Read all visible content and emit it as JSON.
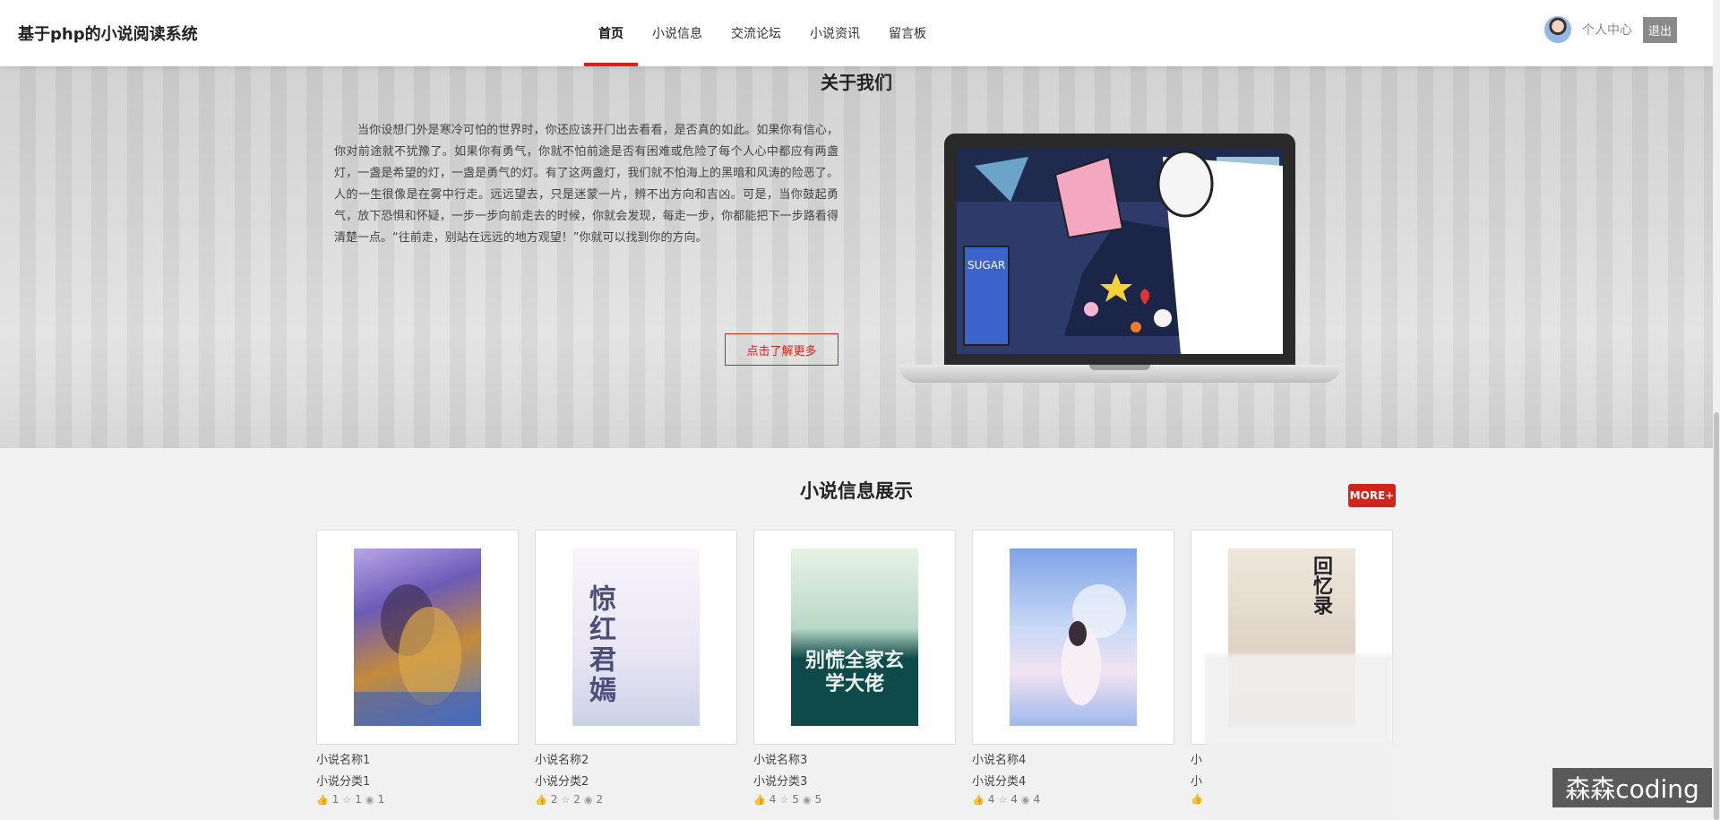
{
  "header": {
    "site_title": "基于php的小说阅读系统",
    "nav": [
      {
        "label": "首页",
        "active": true
      },
      {
        "label": "小说信息",
        "active": false
      },
      {
        "label": "交流论坛",
        "active": false
      },
      {
        "label": "小说资讯",
        "active": false
      },
      {
        "label": "留言板",
        "active": false
      }
    ],
    "user_center": "个人中心",
    "logout": "退出"
  },
  "about": {
    "title": "关于我们",
    "text": "当你设想门外是寒冷可怕的世界时，你还应该开门出去看看，是否真的如此。如果你有信心，你对前途就不犹豫了。如果你有勇气，你就不怕前途是否有困难或危险了每个人心中都应有两盏灯，一盏是希望的灯，一盏是勇气的灯。有了这两盏灯，我们就不怕海上的黑暗和风涛的险恶了。人的一生很像是在雾中行走。远远望去，只是迷蒙一片，辨不出方向和吉凶。可是，当你鼓起勇气，放下恐惧和怀疑，一步一步向前走去的时候，你就会发现，每走一步，你都能把下一步路看得清楚一点。“往前走，别站在远远的地方观望！”你就可以找到你的方向。",
    "more_button": "点击了解更多",
    "illustration_text": "SUGAR"
  },
  "novels": {
    "title": "小说信息展示",
    "more_badge": "MORE+",
    "items": [
      {
        "name": "小说名称1",
        "category": "小说分类1",
        "likes": "1",
        "favorites": "1",
        "views": "1",
        "cover_text": ""
      },
      {
        "name": "小说名称2",
        "category": "小说分类2",
        "likes": "2",
        "favorites": "2",
        "views": "2",
        "cover_text": "惊红君嫣"
      },
      {
        "name": "小说名称3",
        "category": "小说分类3",
        "likes": "4",
        "favorites": "5",
        "views": "5",
        "cover_text": "别慌全家玄学大佬"
      },
      {
        "name": "小说名称4",
        "category": "小说分类4",
        "likes": "4",
        "favorites": "4",
        "views": "4",
        "cover_text": ""
      },
      {
        "name": "小",
        "category": "小",
        "likes": "",
        "favorites": "",
        "views": "",
        "cover_text": "回忆录"
      }
    ]
  },
  "watermark": "森森coding",
  "colors": {
    "accent": "#d6221a",
    "logout_bg": "#8a8a8a"
  }
}
